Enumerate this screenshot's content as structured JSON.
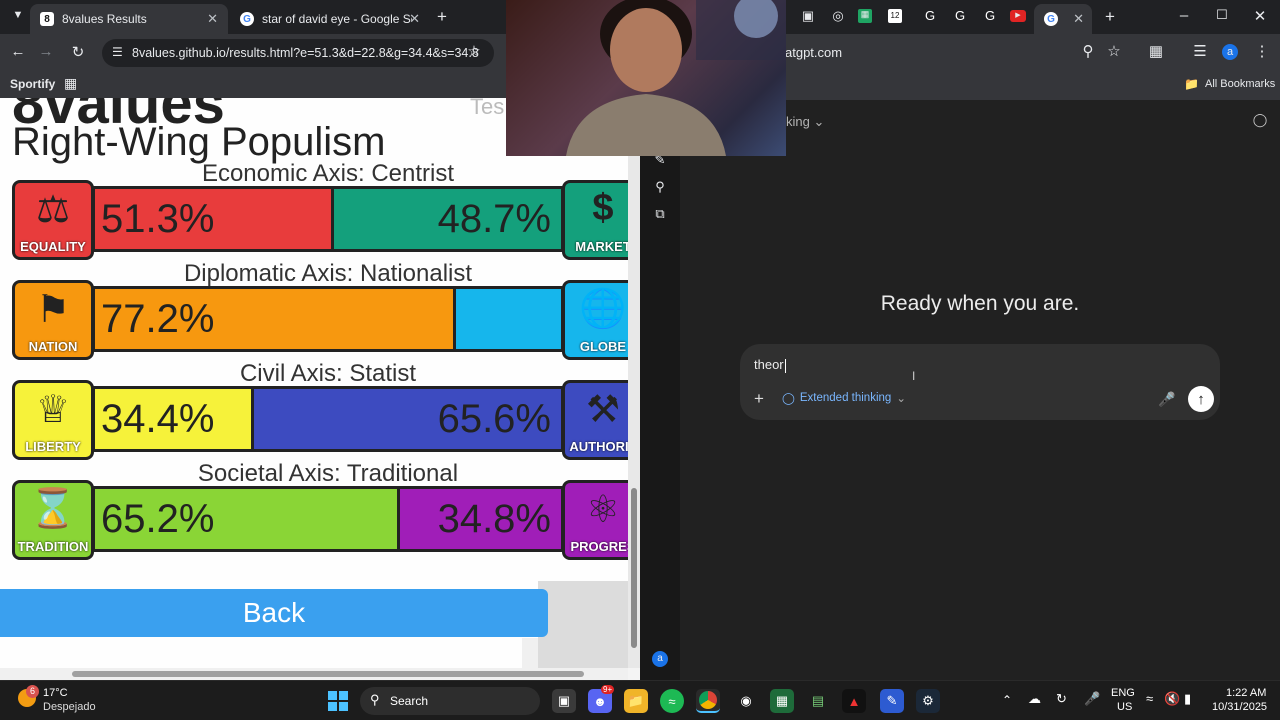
{
  "left_window": {
    "tabs": [
      {
        "title": "8values Results",
        "favicon": "8",
        "active": true
      },
      {
        "title": "star of david eye - Google Sear",
        "favicon": "G",
        "active": false
      }
    ],
    "url": "8values.github.io/results.html?e=51.3&d=22.8&g=34.4&s=34.8",
    "bookmark_label": "Sportify",
    "page": {
      "logo_text": "8values",
      "test_text": "Tes",
      "ideology": "Right-Wing Populism",
      "axes": [
        {
          "label": "Economic Axis: Centrist",
          "left_name": "EQUALITY",
          "right_name": "MARKET",
          "left_value": 51.3,
          "right_value": 48.7,
          "left_text": "51.3%",
          "right_text": "48.7%",
          "left_color": "#e83c3c",
          "right_color": "#14a07c",
          "left_icon": "scales-icon",
          "right_icon": "dollar-icon"
        },
        {
          "label": "Diplomatic Axis: Nationalist",
          "left_name": "NATION",
          "right_name": "GLOBE",
          "left_value": 77.2,
          "right_value": 22.8,
          "left_text": "77.2%",
          "right_text": "",
          "left_color": "#f7980f",
          "right_color": "#16b6ec",
          "left_icon": "flag-icon",
          "right_icon": "globe-icon"
        },
        {
          "label": "Civil Axis: Statist",
          "left_name": "LIBERTY",
          "right_name": "AUTHORIT",
          "left_value": 34.4,
          "right_value": 65.6,
          "left_text": "34.4%",
          "right_text": "65.6%",
          "left_color": "#f6f23a",
          "right_color": "#3d4bc0",
          "left_icon": "statue-of-liberty-icon",
          "right_icon": "gavel-icon"
        },
        {
          "label": "Societal Axis: Traditional",
          "left_name": "TRADITION",
          "right_name": "PROGRES",
          "left_value": 65.2,
          "right_value": 34.8,
          "left_text": "65.2%",
          "right_text": "34.8%",
          "left_color": "#8ad536",
          "right_color": "#a01eb8",
          "left_icon": "hourglass-icon",
          "right_icon": "atom-icon"
        }
      ],
      "back_label": "Back"
    }
  },
  "right_window": {
    "url": "atgpt.com",
    "bookmarks_label": "All Bookmarks",
    "model_label": "king",
    "heading": "Ready when you are.",
    "input_value": "theor",
    "extended_thinking_label": "Extended thinking",
    "avatar_letter": "a",
    "extra_tab_badge": "12"
  },
  "taskbar": {
    "weather_temp": "17°C",
    "weather_desc": "Despejado",
    "weather_badge": "6",
    "search_label": "Search",
    "discord_badge": "9+",
    "lang_line1": "ENG",
    "lang_line2": "US",
    "time": "1:22 AM",
    "date": "10/31/2025"
  }
}
